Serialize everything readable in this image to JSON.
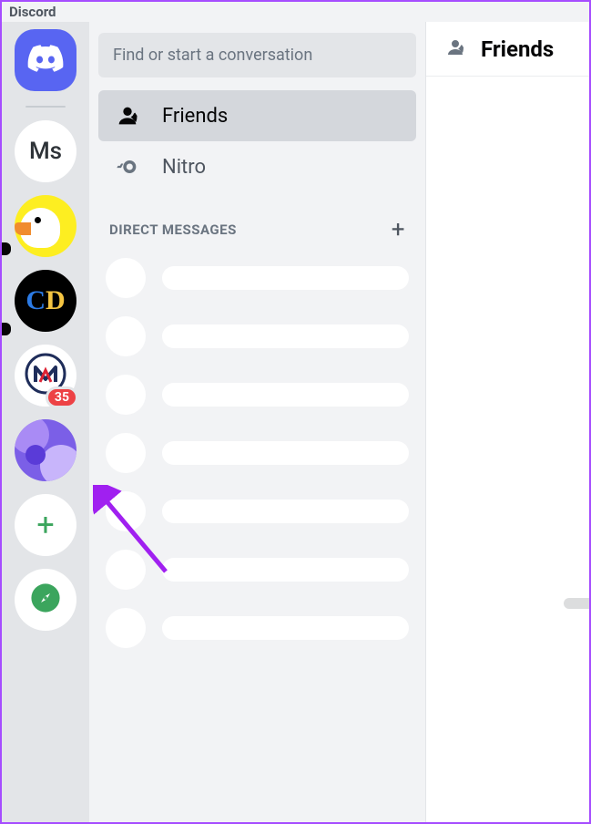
{
  "app_name": "Discord",
  "colors": {
    "blurple": "#5865f2",
    "badge_red": "#ed4245",
    "green": "#3ba55d",
    "arrow": "#a020f0"
  },
  "guilds": {
    "home_label": "Direct Messages",
    "ms_initials": "Ms",
    "cd_initials": "CD",
    "nm_label": "NM",
    "nm_badge": "35",
    "add_label": "+",
    "explore_label": "Explore"
  },
  "channels": {
    "search_placeholder": "Find or start a conversation",
    "friends_label": "Friends",
    "nitro_label": "Nitro",
    "dm_header": "DIRECT MESSAGES",
    "add_dm_label": "+",
    "placeholder_count": 7
  },
  "content": {
    "header_label": "Friends"
  }
}
